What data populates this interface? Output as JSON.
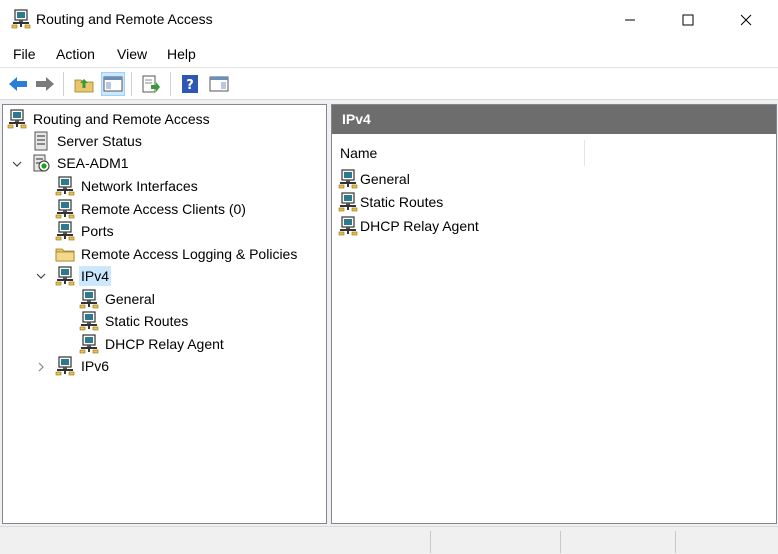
{
  "window": {
    "title": "Routing and Remote Access"
  },
  "menu": {
    "file": "File",
    "action": "Action",
    "view": "View",
    "help": "Help"
  },
  "tree": {
    "root": "Routing and Remote Access",
    "server_status": "Server Status",
    "server": "SEA-ADM1",
    "network_interfaces": "Network Interfaces",
    "remote_access_clients": "Remote Access Clients (0)",
    "ports": "Ports",
    "logging": "Remote Access Logging & Policies",
    "ipv4": "IPv4",
    "general": "General",
    "static_routes": "Static Routes",
    "dhcp_relay": "DHCP Relay Agent",
    "ipv6": "IPv6"
  },
  "detail": {
    "header": "IPv4",
    "column_name": "Name",
    "items": [
      "General",
      "Static Routes",
      "DHCP Relay Agent"
    ]
  },
  "colors": {
    "accent": "#cce8ff",
    "header_bg": "#6d6d6d"
  }
}
